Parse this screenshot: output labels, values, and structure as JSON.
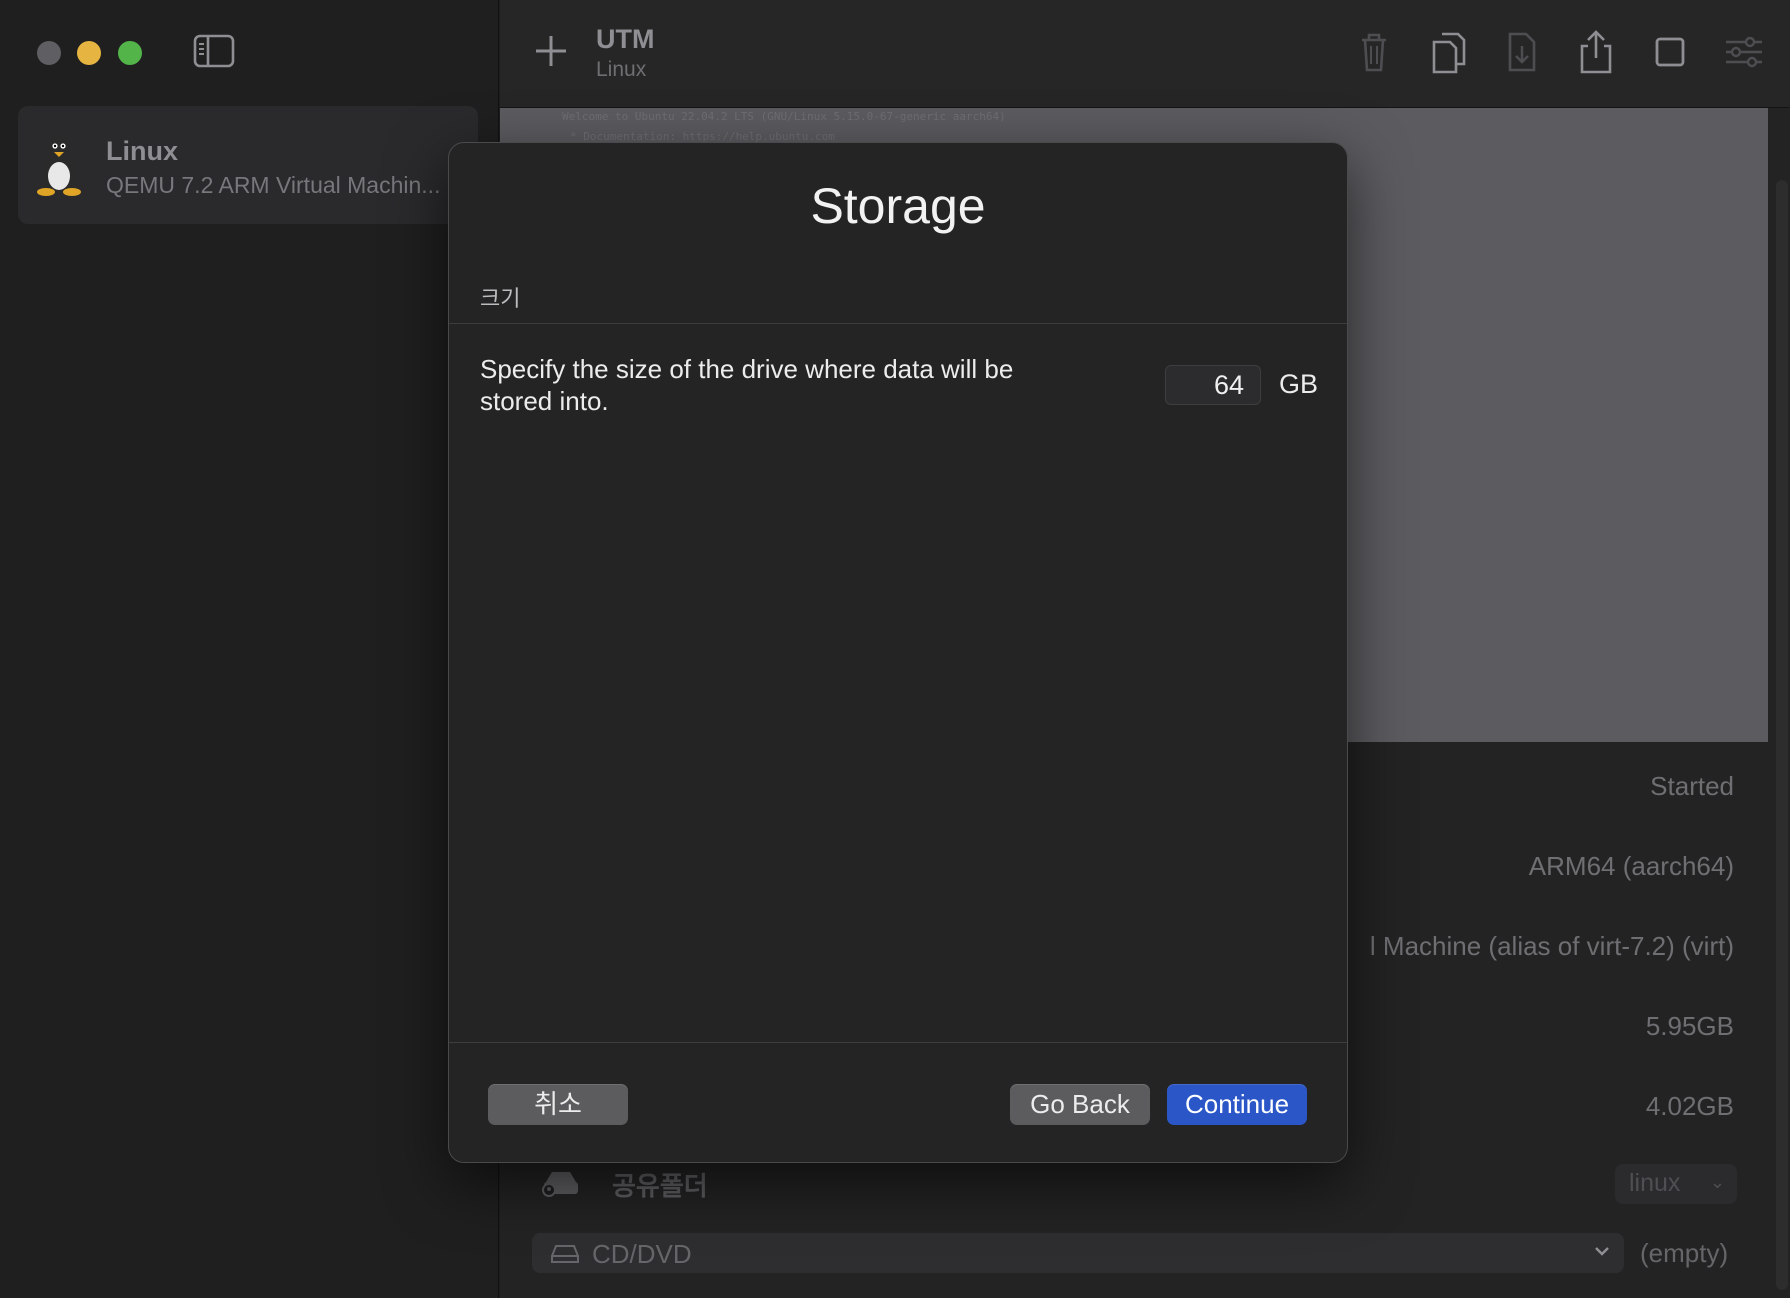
{
  "sidebar": {
    "vm": {
      "name": "Linux",
      "description": "QEMU 7.2 ARM Virtual Machin..."
    }
  },
  "toolbar": {
    "title": "UTM",
    "subtitle": "Linux",
    "icons": [
      "plus-icon",
      "trash-icon",
      "clone-icon",
      "download-icon",
      "share-icon",
      "stop-icon",
      "settings-icon"
    ]
  },
  "preview": {
    "console_lines": [
      "Welcome to Ubuntu 22.04.2 LTS (GNU/Linux 5.15.0-67-generic aarch64)",
      " * Documentation:  https://help.ubuntu.com"
    ]
  },
  "info": {
    "status": "Started",
    "architecture": "ARM64 (aarch64)",
    "machine": "l Machine (alias of virt-7.2) (virt)",
    "memory": "5.95GB",
    "size": "4.02GB"
  },
  "shared_folder": {
    "label": "공유폴더",
    "value": "linux"
  },
  "cd_dvd": {
    "label": "CD/DVD",
    "value": "(empty)"
  },
  "modal": {
    "title": "Storage",
    "section_label": "크기",
    "description": "Specify the size of the drive where data will be stored into.",
    "size_value": "64",
    "size_unit": "GB",
    "cancel_label": "취소",
    "back_label": "Go Back",
    "continue_label": "Continue"
  },
  "colors": {
    "accent": "#2b56c8",
    "traffic_close": "#5f5f63",
    "traffic_minimize": "#e6b440",
    "traffic_maximize": "#53b44a"
  }
}
